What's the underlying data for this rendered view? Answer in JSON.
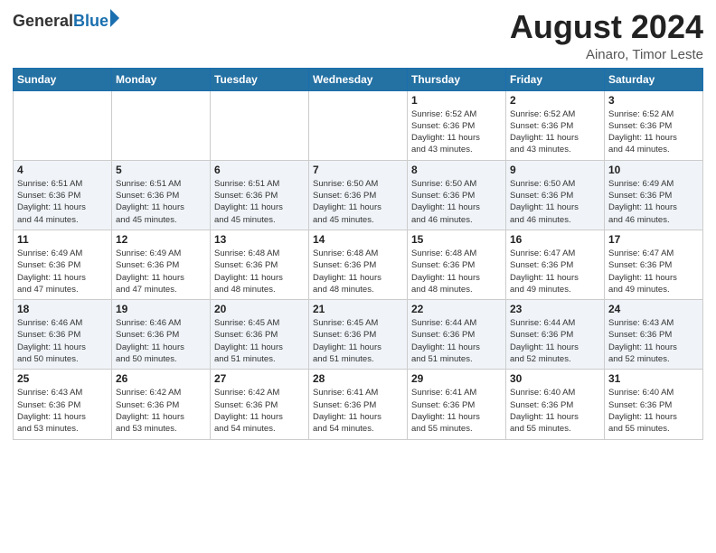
{
  "header": {
    "logo_general": "General",
    "logo_blue": "Blue",
    "month_year": "August 2024",
    "location": "Ainaro, Timor Leste"
  },
  "days_of_week": [
    "Sunday",
    "Monday",
    "Tuesday",
    "Wednesday",
    "Thursday",
    "Friday",
    "Saturday"
  ],
  "weeks": [
    [
      {
        "day": "",
        "info": ""
      },
      {
        "day": "",
        "info": ""
      },
      {
        "day": "",
        "info": ""
      },
      {
        "day": "",
        "info": ""
      },
      {
        "day": "1",
        "info": "Sunrise: 6:52 AM\nSunset: 6:36 PM\nDaylight: 11 hours\nand 43 minutes."
      },
      {
        "day": "2",
        "info": "Sunrise: 6:52 AM\nSunset: 6:36 PM\nDaylight: 11 hours\nand 43 minutes."
      },
      {
        "day": "3",
        "info": "Sunrise: 6:52 AM\nSunset: 6:36 PM\nDaylight: 11 hours\nand 44 minutes."
      }
    ],
    [
      {
        "day": "4",
        "info": "Sunrise: 6:51 AM\nSunset: 6:36 PM\nDaylight: 11 hours\nand 44 minutes."
      },
      {
        "day": "5",
        "info": "Sunrise: 6:51 AM\nSunset: 6:36 PM\nDaylight: 11 hours\nand 45 minutes."
      },
      {
        "day": "6",
        "info": "Sunrise: 6:51 AM\nSunset: 6:36 PM\nDaylight: 11 hours\nand 45 minutes."
      },
      {
        "day": "7",
        "info": "Sunrise: 6:50 AM\nSunset: 6:36 PM\nDaylight: 11 hours\nand 45 minutes."
      },
      {
        "day": "8",
        "info": "Sunrise: 6:50 AM\nSunset: 6:36 PM\nDaylight: 11 hours\nand 46 minutes."
      },
      {
        "day": "9",
        "info": "Sunrise: 6:50 AM\nSunset: 6:36 PM\nDaylight: 11 hours\nand 46 minutes."
      },
      {
        "day": "10",
        "info": "Sunrise: 6:49 AM\nSunset: 6:36 PM\nDaylight: 11 hours\nand 46 minutes."
      }
    ],
    [
      {
        "day": "11",
        "info": "Sunrise: 6:49 AM\nSunset: 6:36 PM\nDaylight: 11 hours\nand 47 minutes."
      },
      {
        "day": "12",
        "info": "Sunrise: 6:49 AM\nSunset: 6:36 PM\nDaylight: 11 hours\nand 47 minutes."
      },
      {
        "day": "13",
        "info": "Sunrise: 6:48 AM\nSunset: 6:36 PM\nDaylight: 11 hours\nand 48 minutes."
      },
      {
        "day": "14",
        "info": "Sunrise: 6:48 AM\nSunset: 6:36 PM\nDaylight: 11 hours\nand 48 minutes."
      },
      {
        "day": "15",
        "info": "Sunrise: 6:48 AM\nSunset: 6:36 PM\nDaylight: 11 hours\nand 48 minutes."
      },
      {
        "day": "16",
        "info": "Sunrise: 6:47 AM\nSunset: 6:36 PM\nDaylight: 11 hours\nand 49 minutes."
      },
      {
        "day": "17",
        "info": "Sunrise: 6:47 AM\nSunset: 6:36 PM\nDaylight: 11 hours\nand 49 minutes."
      }
    ],
    [
      {
        "day": "18",
        "info": "Sunrise: 6:46 AM\nSunset: 6:36 PM\nDaylight: 11 hours\nand 50 minutes."
      },
      {
        "day": "19",
        "info": "Sunrise: 6:46 AM\nSunset: 6:36 PM\nDaylight: 11 hours\nand 50 minutes."
      },
      {
        "day": "20",
        "info": "Sunrise: 6:45 AM\nSunset: 6:36 PM\nDaylight: 11 hours\nand 51 minutes."
      },
      {
        "day": "21",
        "info": "Sunrise: 6:45 AM\nSunset: 6:36 PM\nDaylight: 11 hours\nand 51 minutes."
      },
      {
        "day": "22",
        "info": "Sunrise: 6:44 AM\nSunset: 6:36 PM\nDaylight: 11 hours\nand 51 minutes."
      },
      {
        "day": "23",
        "info": "Sunrise: 6:44 AM\nSunset: 6:36 PM\nDaylight: 11 hours\nand 52 minutes."
      },
      {
        "day": "24",
        "info": "Sunrise: 6:43 AM\nSunset: 6:36 PM\nDaylight: 11 hours\nand 52 minutes."
      }
    ],
    [
      {
        "day": "25",
        "info": "Sunrise: 6:43 AM\nSunset: 6:36 PM\nDaylight: 11 hours\nand 53 minutes."
      },
      {
        "day": "26",
        "info": "Sunrise: 6:42 AM\nSunset: 6:36 PM\nDaylight: 11 hours\nand 53 minutes."
      },
      {
        "day": "27",
        "info": "Sunrise: 6:42 AM\nSunset: 6:36 PM\nDaylight: 11 hours\nand 54 minutes."
      },
      {
        "day": "28",
        "info": "Sunrise: 6:41 AM\nSunset: 6:36 PM\nDaylight: 11 hours\nand 54 minutes."
      },
      {
        "day": "29",
        "info": "Sunrise: 6:41 AM\nSunset: 6:36 PM\nDaylight: 11 hours\nand 55 minutes."
      },
      {
        "day": "30",
        "info": "Sunrise: 6:40 AM\nSunset: 6:36 PM\nDaylight: 11 hours\nand 55 minutes."
      },
      {
        "day": "31",
        "info": "Sunrise: 6:40 AM\nSunset: 6:36 PM\nDaylight: 11 hours\nand 55 minutes."
      }
    ]
  ]
}
